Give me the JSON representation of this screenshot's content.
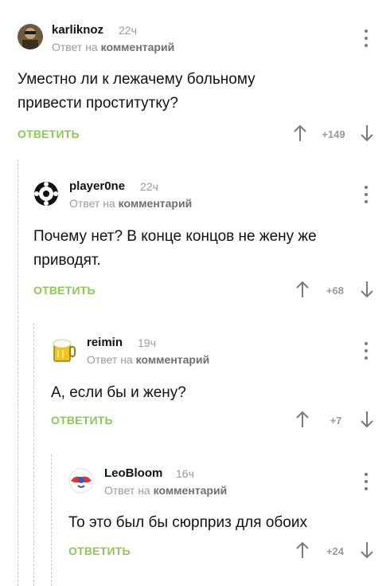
{
  "comments": [
    {
      "username": "karliknoz",
      "time": "22ч",
      "reply_prefix": "Ответ на",
      "reply_target": "комментарий",
      "text": "Уместно ли к лежачему больному привести проститутку?",
      "reply_label": "ОТВЕТИТЬ",
      "rating": "+149"
    },
    {
      "username": "player0ne",
      "time": "22ч",
      "reply_prefix": "Ответ на",
      "reply_target": "комментарий",
      "text": "Почему нет? В конце концов не жену же приводят.",
      "reply_label": "ОТВЕТИТЬ",
      "rating": "+68"
    },
    {
      "username": "reimin",
      "time": "19ч",
      "reply_prefix": "Ответ на",
      "reply_target": "комментарий",
      "text": "А, если бы и жену?",
      "reply_label": "ОТВЕТИТЬ",
      "rating": "+7"
    },
    {
      "username": "LeoBloom",
      "time": "16ч",
      "reply_prefix": "Ответ на",
      "reply_target": "комментарий",
      "text": "То это был бы сюрприз для обоих",
      "reply_label": "ОТВЕТИТЬ",
      "rating": "+24"
    }
  ],
  "colors": {
    "reply_button": "#8ac858",
    "muted_text": "#9a9a9a",
    "icon": "#7a7a7a"
  },
  "icons": {
    "more": "more-vertical-icon",
    "upvote": "arrow-up-icon",
    "downvote": "arrow-down-icon"
  }
}
